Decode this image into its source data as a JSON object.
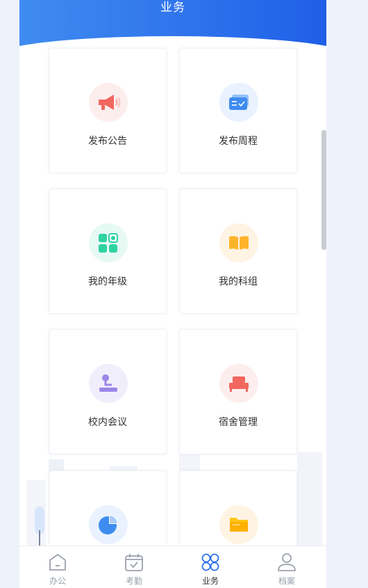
{
  "header": {
    "title": "业务"
  },
  "cards": [
    {
      "label": "发布公告",
      "icon": "megaphone-icon",
      "bg": "#fdeeee",
      "color": "#f2675f"
    },
    {
      "label": "发布周程",
      "icon": "schedule-cards-icon",
      "bg": "#e9f2fe",
      "color": "#3f8cf0"
    },
    {
      "label": "我的年级",
      "icon": "grid-blocks-icon",
      "bg": "#e6f9f3",
      "color": "#2ed3a0"
    },
    {
      "label": "我的科组",
      "icon": "open-book-icon",
      "bg": "#fff4e4",
      "color": "#ffb42b"
    },
    {
      "label": "校内会议",
      "icon": "microphone-stand-icon",
      "bg": "#f1eefc",
      "color": "#9b86e8"
    },
    {
      "label": "宿舍管理",
      "icon": "bed-icon",
      "bg": "#fdeeee",
      "color": "#f2675f"
    },
    {
      "label": "",
      "icon": "pie-chart-icon",
      "bg": "#e9f2fe",
      "color": "#3f8cf0"
    },
    {
      "label": "",
      "icon": "folder-icon",
      "bg": "#fff4e4",
      "color": "#ffc61a"
    }
  ],
  "tabs": [
    {
      "label": "办公",
      "icon": "home-icon",
      "active": false
    },
    {
      "label": "考勤",
      "icon": "calendar-check-icon",
      "active": false
    },
    {
      "label": "业务",
      "icon": "four-circles-icon",
      "active": true
    },
    {
      "label": "档案",
      "icon": "user-profile-icon",
      "active": false
    }
  ],
  "colors": {
    "primary": "#2f73ec",
    "inactive": "#9ba1ad"
  }
}
